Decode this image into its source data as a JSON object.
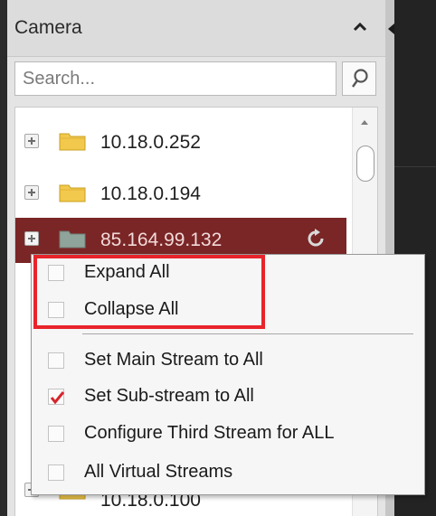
{
  "panel": {
    "title": "Camera",
    "collapse_icon": "chevron-up-icon"
  },
  "search": {
    "placeholder": "Search...",
    "icon": "search-icon"
  },
  "tree": {
    "items": [
      {
        "label": "10.18.0.252",
        "icon": "folder-icon"
      },
      {
        "label": "10.18.0.194",
        "icon": "folder-icon"
      },
      {
        "label": "85.164.99.132",
        "icon": "folder-icon",
        "selected": true,
        "action_icon": "refresh-icon"
      },
      {
        "label": "10.18.0.100",
        "icon": "folder-icon"
      }
    ]
  },
  "context_menu": {
    "items": [
      {
        "label": "Expand All",
        "checked": false
      },
      {
        "label": "Collapse All",
        "checked": false
      },
      {
        "label": "Set Main Stream to All",
        "checked": false
      },
      {
        "label": "Set Sub-stream to All",
        "checked": true
      },
      {
        "label": "Configure Third Stream for ALL",
        "checked": false
      },
      {
        "label": "All Virtual Streams",
        "checked": false
      }
    ]
  },
  "colors": {
    "selected_row": "#7a2626",
    "highlight": "#e8242b",
    "checkmark": "#d6252b",
    "folder": "#f2c94c"
  }
}
